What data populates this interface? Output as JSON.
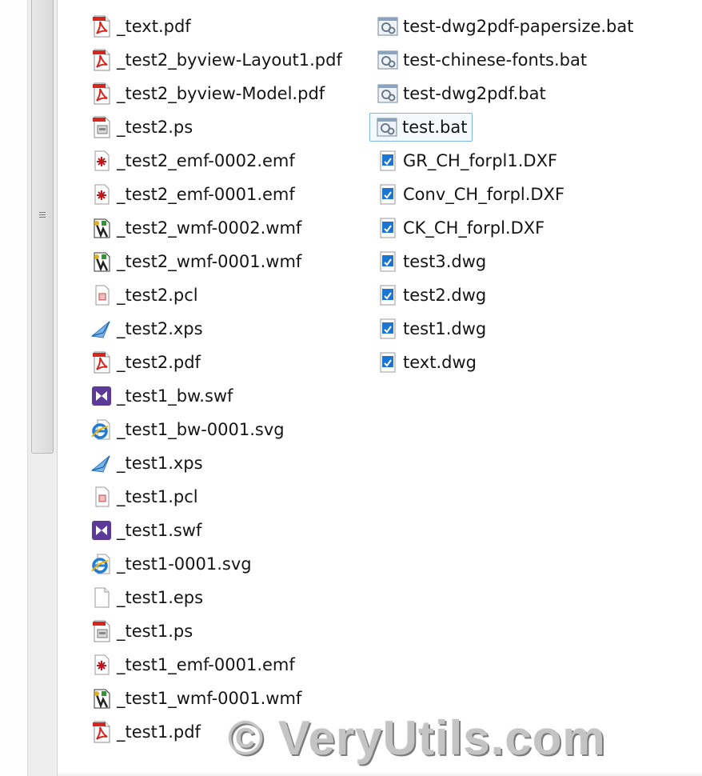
{
  "explorer": {
    "columns": [
      {
        "items": [
          {
            "name": "_text.pdf",
            "icon": "pdf-icon"
          },
          {
            "name": "_test2_byview-Layout1.pdf",
            "icon": "pdf-icon"
          },
          {
            "name": "_test2_byview-Model.pdf",
            "icon": "pdf-icon"
          },
          {
            "name": "_test2.ps",
            "icon": "ps-icon"
          },
          {
            "name": "_test2_emf-0002.emf",
            "icon": "emf-icon"
          },
          {
            "name": "_test2_emf-0001.emf",
            "icon": "emf-icon"
          },
          {
            "name": "_test2_wmf-0002.wmf",
            "icon": "wmf-icon"
          },
          {
            "name": "_test2_wmf-0001.wmf",
            "icon": "wmf-icon"
          },
          {
            "name": "_test2.pcl",
            "icon": "pcl-icon"
          },
          {
            "name": "_test2.xps",
            "icon": "xps-icon"
          },
          {
            "name": "_test2.pdf",
            "icon": "pdf-icon"
          },
          {
            "name": "_test1_bw.swf",
            "icon": "swf-icon"
          },
          {
            "name": "_test1_bw-0001.svg",
            "icon": "svg-ie-icon"
          },
          {
            "name": "_test1.xps",
            "icon": "xps-icon"
          },
          {
            "name": "_test1.pcl",
            "icon": "pcl-icon"
          },
          {
            "name": "_test1.swf",
            "icon": "swf-icon"
          },
          {
            "name": "_test1-0001.svg",
            "icon": "svg-ie-icon"
          },
          {
            "name": "_test1.eps",
            "icon": "blank-file-icon"
          },
          {
            "name": "_test1.ps",
            "icon": "ps-icon"
          },
          {
            "name": "_test1_emf-0001.emf",
            "icon": "emf-icon"
          },
          {
            "name": "_test1_wmf-0001.wmf",
            "icon": "wmf-icon"
          },
          {
            "name": "_test1.pdf",
            "icon": "pdf-icon"
          }
        ]
      },
      {
        "items": [
          {
            "name": "test-dwg2pdf-papersize.bat",
            "icon": "bat-icon"
          },
          {
            "name": "test-chinese-fonts.bat",
            "icon": "bat-icon"
          },
          {
            "name": "test-dwg2pdf.bat",
            "icon": "bat-icon"
          },
          {
            "name": "test.bat",
            "icon": "bat-icon",
            "selected": true
          },
          {
            "name": "GR_CH_forpl1.DXF",
            "icon": "dxf-icon"
          },
          {
            "name": "Conv_CH_forpl.DXF",
            "icon": "dxf-icon"
          },
          {
            "name": "CK_CH_forpl.DXF",
            "icon": "dxf-icon"
          },
          {
            "name": "test3.dwg",
            "icon": "dwg-icon"
          },
          {
            "name": "test2.dwg",
            "icon": "dwg-icon"
          },
          {
            "name": "test1.dwg",
            "icon": "dwg-icon"
          },
          {
            "name": "text.dwg",
            "icon": "dwg-icon"
          }
        ]
      }
    ]
  },
  "watermark": {
    "text": "© VeryUtils.com"
  },
  "colors": {
    "selection_border": "#7eb4ea",
    "pdf_red": "#d7261e",
    "dwg_blue": "#1b76d3",
    "swf_purple": "#5b3a98"
  }
}
